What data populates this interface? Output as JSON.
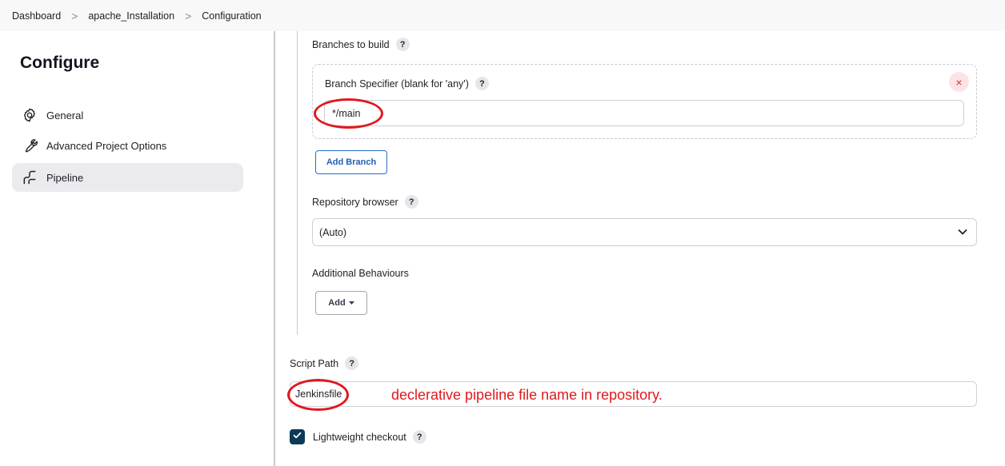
{
  "breadcrumb": {
    "items": [
      "Dashboard",
      "apache_Installation",
      "Configuration"
    ],
    "separator": ">"
  },
  "sidebar": {
    "title": "Configure",
    "items": [
      {
        "label": "General",
        "icon": "gear-icon"
      },
      {
        "label": "Advanced Project Options",
        "icon": "wrench-icon"
      },
      {
        "label": "Pipeline",
        "icon": "pipeline-icon",
        "active": true
      }
    ]
  },
  "main": {
    "branches_to_build_label": "Branches to build",
    "branch_specifier_label": "Branch Specifier (blank for 'any')",
    "branch_specifier_value": "*/main",
    "remove_icon": "×",
    "add_branch_label": "Add Branch",
    "repository_browser_label": "Repository browser",
    "repository_browser_value": "(Auto)",
    "additional_behaviours_label": "Additional Behaviours",
    "add_label": "Add",
    "script_path_label": "Script Path",
    "script_path_value": "Jenkinsfile",
    "lightweight_checkout_label": "Lightweight checkout",
    "lightweight_checkout_checked": true,
    "help_glyph": "?"
  },
  "annotation": {
    "text": "declerative pipeline file name in repository.",
    "color": "#e0191e"
  },
  "colors": {
    "accent": "#2360b4",
    "checkbox": "#0d3a56",
    "remove": "#d9303a"
  }
}
